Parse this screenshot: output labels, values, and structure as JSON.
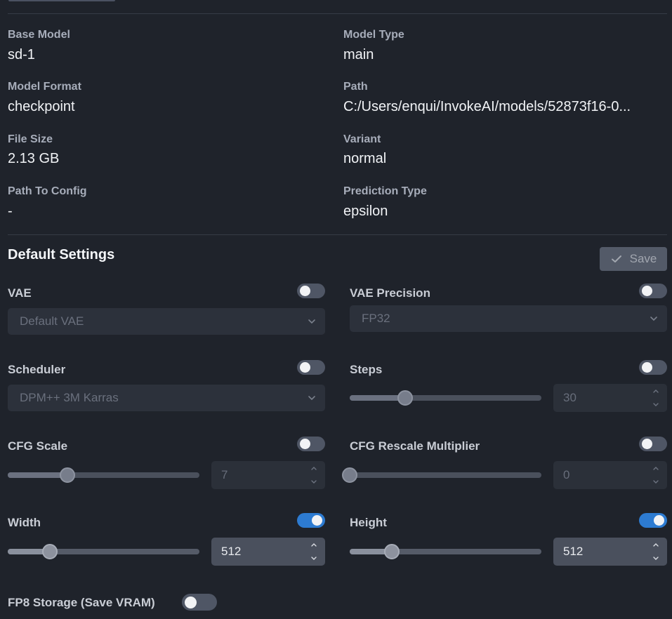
{
  "model_info": {
    "base_model": {
      "label": "Base Model",
      "value": "sd-1"
    },
    "model_type": {
      "label": "Model Type",
      "value": "main"
    },
    "model_format": {
      "label": "Model Format",
      "value": "checkpoint"
    },
    "path": {
      "label": "Path",
      "value": "C:/Users/enqui/InvokeAI/models/52873f16-0..."
    },
    "file_size": {
      "label": "File Size",
      "value": "2.13 GB"
    },
    "variant": {
      "label": "Variant",
      "value": "normal"
    },
    "path_to_config": {
      "label": "Path To Config",
      "value": "-"
    },
    "prediction_type": {
      "label": "Prediction Type",
      "value": "epsilon"
    }
  },
  "default_settings": {
    "title": "Default Settings",
    "save_label": "Save",
    "vae": {
      "label": "VAE",
      "enabled": false,
      "value": "Default VAE"
    },
    "vae_precision": {
      "label": "VAE Precision",
      "enabled": false,
      "value": "FP32"
    },
    "scheduler": {
      "label": "Scheduler",
      "enabled": false,
      "value": "DPM++ 3M Karras"
    },
    "steps": {
      "label": "Steps",
      "enabled": false,
      "value": "30",
      "slider_fraction": 0.29
    },
    "cfg_scale": {
      "label": "CFG Scale",
      "enabled": false,
      "value": "7",
      "slider_fraction": 0.31
    },
    "cfg_rescale": {
      "label": "CFG Rescale Multiplier",
      "enabled": false,
      "value": "0",
      "slider_fraction": 0.0
    },
    "width": {
      "label": "Width",
      "enabled": true,
      "value": "512",
      "slider_fraction": 0.22
    },
    "height": {
      "label": "Height",
      "enabled": true,
      "value": "512",
      "slider_fraction": 0.22
    },
    "fp8_storage": {
      "label": "FP8 Storage (Save VRAM)",
      "enabled": false
    }
  },
  "icons": {
    "check": "check-icon",
    "chevron_down": "chevron-down-icon",
    "chevron_up": "chevron-up-icon"
  }
}
